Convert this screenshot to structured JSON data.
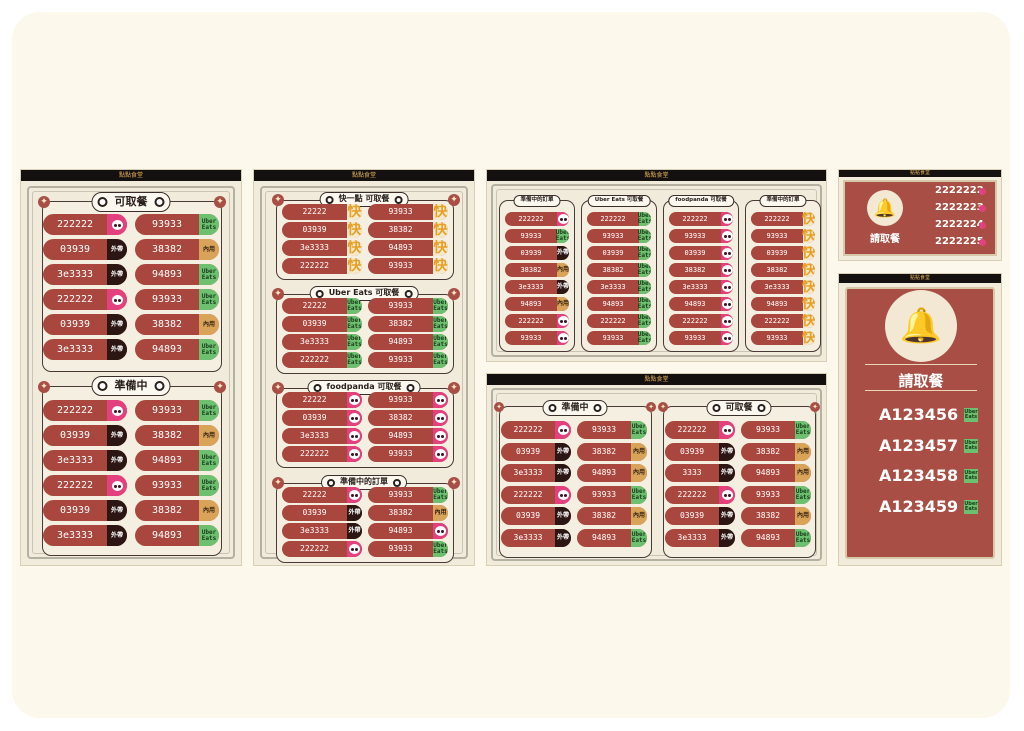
{
  "app": {
    "brand": "點點食堂"
  },
  "badges": {
    "out": "外帶",
    "in": "內用",
    "uber": "Uber Eats",
    "fast": "快"
  },
  "screen1": {
    "ready_title": "可取餐",
    "prep_title": "準備中",
    "ready_left": [
      "222222",
      "03939",
      "3e3333",
      "222222",
      "03939",
      "3e3333"
    ],
    "ready_left_badges": [
      "panda",
      "out",
      "out",
      "panda",
      "out",
      "out"
    ],
    "ready_right": [
      "93933",
      "38382",
      "94893",
      "93933",
      "38382",
      "94893"
    ],
    "ready_right_badges": [
      "uber",
      "in",
      "uber",
      "uber",
      "in",
      "uber"
    ],
    "prep_left": [
      "222222",
      "03939",
      "3e3333",
      "222222",
      "03939",
      "3e3333"
    ],
    "prep_left_badges": [
      "panda",
      "out",
      "out",
      "panda",
      "out",
      "out"
    ],
    "prep_right": [
      "93933",
      "38382",
      "94893",
      "93933",
      "38382",
      "94893"
    ],
    "prep_right_badges": [
      "uber",
      "in",
      "uber",
      "uber",
      "in",
      "uber"
    ]
  },
  "screen2": {
    "sections": [
      {
        "title": "快一點 可取餐",
        "left": [
          "22222",
          "03939",
          "3e3333",
          "222222"
        ],
        "left_badges": [
          "fast",
          "fast",
          "fast",
          "fast"
        ],
        "right": [
          "93933",
          "38382",
          "94893",
          "93933"
        ],
        "right_badges": [
          "fast",
          "fast",
          "fast",
          "fast"
        ]
      },
      {
        "title": "Uber Eats 可取餐",
        "left": [
          "22222",
          "03939",
          "3e3333",
          "222222"
        ],
        "left_badges": [
          "uber",
          "uber",
          "uber",
          "uber"
        ],
        "right": [
          "93933",
          "38382",
          "94893",
          "93933"
        ],
        "right_badges": [
          "uber",
          "uber",
          "uber",
          "uber"
        ]
      },
      {
        "title": "foodpanda 可取餐",
        "left": [
          "22222",
          "03939",
          "3e3333",
          "222222"
        ],
        "left_badges": [
          "panda",
          "panda",
          "panda",
          "panda"
        ],
        "right": [
          "93933",
          "38382",
          "94893",
          "93933"
        ],
        "right_badges": [
          "panda",
          "panda",
          "panda",
          "panda"
        ]
      },
      {
        "title": "準備中的訂單",
        "left": [
          "22222",
          "03939",
          "3e3333",
          "222222"
        ],
        "left_badges": [
          "panda",
          "out",
          "out",
          "panda"
        ],
        "right": [
          "93933",
          "38382",
          "94893",
          "93933"
        ],
        "right_badges": [
          "uber",
          "in",
          "panda",
          "uber"
        ]
      }
    ]
  },
  "screen3": {
    "columns": [
      {
        "title": "準備中的訂單",
        "items": [
          "222222",
          "93933",
          "03939",
          "38382",
          "3e3333",
          "94893",
          "222222",
          "93933"
        ],
        "badges": [
          "panda",
          "uber",
          "out",
          "in",
          "out",
          "in",
          "panda",
          "panda"
        ]
      },
      {
        "title": "Uber Eats 可取餐",
        "items": [
          "222222",
          "93933",
          "03939",
          "38382",
          "3e3333",
          "94893",
          "222222",
          "93933"
        ],
        "badges": [
          "uber",
          "uber",
          "uber",
          "uber",
          "uber",
          "uber",
          "uber",
          "uber"
        ]
      },
      {
        "title": "foodpanda 可取餐",
        "items": [
          "222222",
          "93933",
          "03939",
          "38382",
          "3e3333",
          "94893",
          "222222",
          "93933"
        ],
        "badges": [
          "panda",
          "panda",
          "panda",
          "panda",
          "panda",
          "panda",
          "panda",
          "panda"
        ]
      },
      {
        "title": "準備中的訂單",
        "items": [
          "222222",
          "93933",
          "03939",
          "38382",
          "3e3333",
          "94893",
          "222222",
          "93933"
        ],
        "badges": [
          "fast",
          "fast",
          "fast",
          "fast",
          "fast",
          "fast",
          "fast",
          "fast"
        ]
      }
    ]
  },
  "screen4": {
    "prep_title": "準備中",
    "ready_title": "可取餐",
    "prep_left": [
      "222222",
      "03939",
      "3e3333",
      "222222",
      "03939",
      "3e3333"
    ],
    "prep_left_badges": [
      "panda",
      "out",
      "out",
      "panda",
      "out",
      "out"
    ],
    "prep_right": [
      "93933",
      "38382",
      "94893",
      "93933",
      "38382",
      "94893"
    ],
    "prep_right_badges": [
      "uber",
      "in",
      "in",
      "uber",
      "in",
      "uber"
    ],
    "ready_left": [
      "222222",
      "03939",
      "3333",
      "222222",
      "03939",
      "3e3333"
    ],
    "ready_left_badges": [
      "panda",
      "out",
      "out",
      "panda",
      "out",
      "out"
    ],
    "ready_right": [
      "93933",
      "38382",
      "94893",
      "93933",
      "38382",
      "94893"
    ],
    "ready_right_badges": [
      "uber",
      "in",
      "in",
      "uber",
      "in",
      "uber"
    ]
  },
  "screen5": {
    "notify_label": "請取餐",
    "codes": [
      "2222222",
      "2222223",
      "2222224",
      "2222225"
    ]
  },
  "screen6": {
    "notify_label": "請取餐",
    "codes": [
      "A123456",
      "A123457",
      "A123458",
      "A123459"
    ]
  },
  "colors": {
    "accent_red": "#a94e44",
    "panda_pink": "#e2417d",
    "uber_green": "#6ec071",
    "dark": "#2b1614",
    "gold": "#e6a028"
  }
}
